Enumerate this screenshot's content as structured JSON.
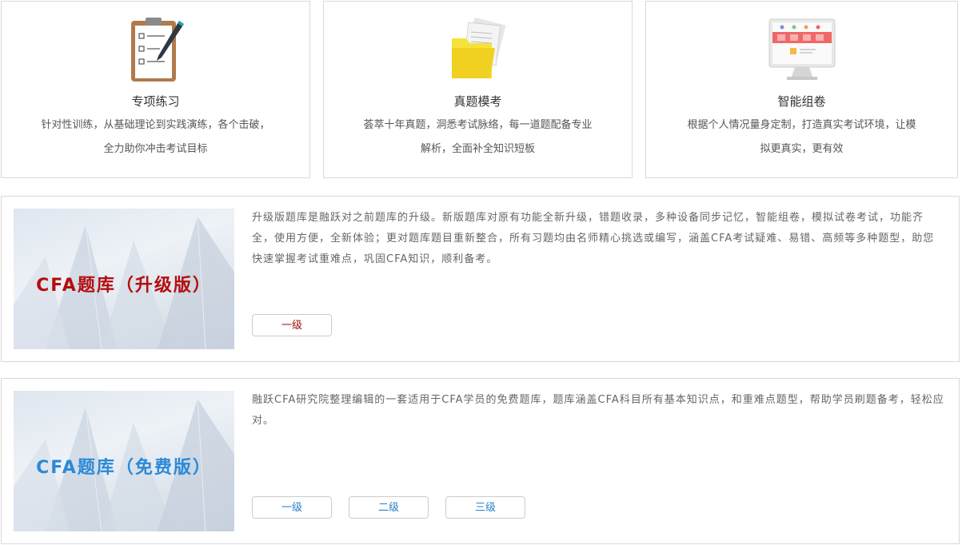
{
  "features": [
    {
      "icon": "clipboard-checklist-icon",
      "title": "专项练习",
      "desc_line1": "针对性训练，从基础理论到实践演练，各个击破，",
      "desc_line2": "全力助你冲击考试目标"
    },
    {
      "icon": "folder-documents-icon",
      "title": "真题模考",
      "desc_line1": "荟萃十年真题，洞悉考试脉络，每一道题配备专业",
      "desc_line2": "解析，全面补全知识短板"
    },
    {
      "icon": "monitor-layout-icon",
      "title": "智能组卷",
      "desc_line1": "根据个人情况量身定制，打造真实考试环境，让模",
      "desc_line2": "拟更真实，更有效"
    }
  ],
  "banks": {
    "upgraded": {
      "banner_title": "CFA题库（升级版）",
      "description": "升级版题库是融跃对之前题库的升级。新版题库对原有功能全新升级，错题收录，多种设备同步记忆，智能组卷，模拟试卷考试，功能齐全，使用方便，全新体验；更对题库题目重新整合，所有习题均由名师精心挑选或编写，涵盖CFA考试疑难、易错、高频等多种题型，助您快速掌握考试重难点，巩固CFA知识，顺利备考。",
      "levels": [
        "一级"
      ],
      "accent_color": "#b50d0d"
    },
    "free": {
      "banner_title": "CFA题库（免费版）",
      "description": "融跃CFA研究院整理编辑的一套适用于CFA学员的免费题库，题库涵盖CFA科目所有基本知识点，和重难点题型，帮助学员刷题备考，轻松应对。",
      "levels": [
        "一级",
        "二级",
        "三级"
      ],
      "accent_color": "#2a8ad8"
    }
  }
}
